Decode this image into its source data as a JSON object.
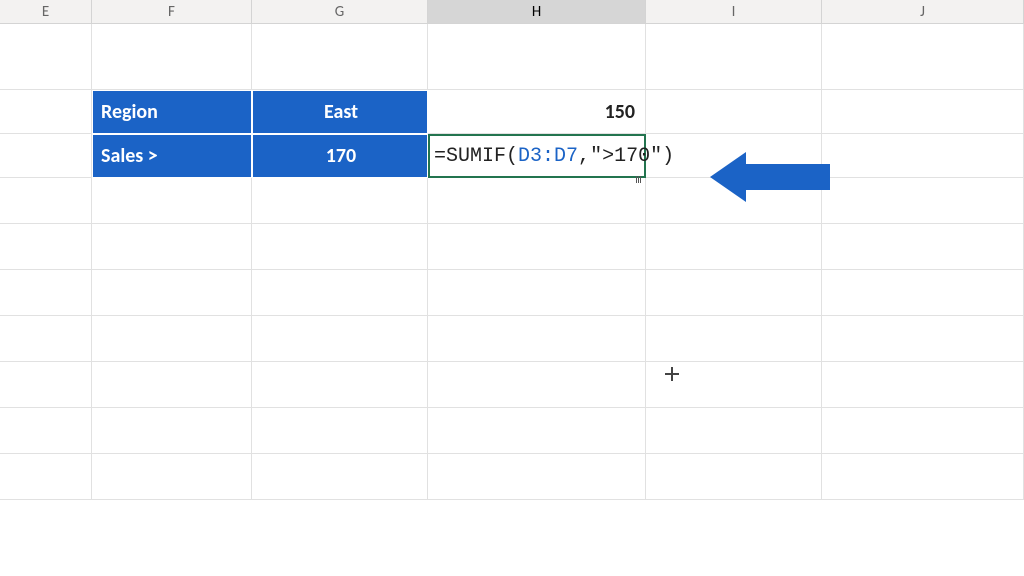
{
  "columns": {
    "E": "E",
    "F": "F",
    "G": "G",
    "H": "H",
    "I": "I",
    "J": "J"
  },
  "data": {
    "F2": "Region",
    "G2": "East",
    "H2": "150",
    "F3": "Sales >",
    "G3": "170"
  },
  "formula": {
    "prefix": "=SUMIF",
    "open": "(",
    "ref": "D3:D7",
    "comma": ",",
    "criteria": "\">170\"",
    "close": ")"
  }
}
